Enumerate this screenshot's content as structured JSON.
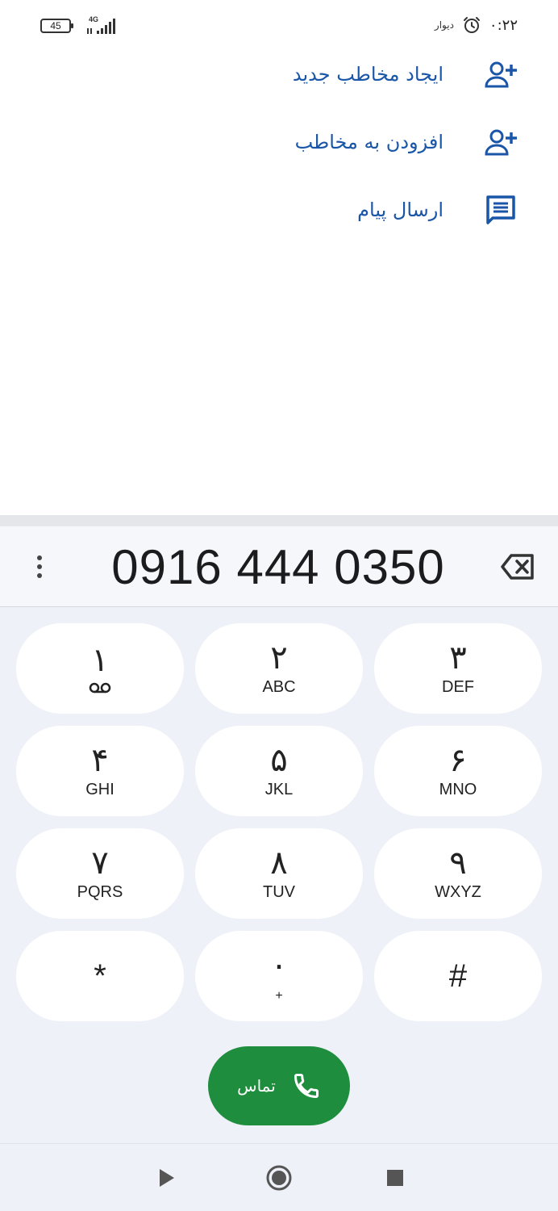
{
  "status_bar": {
    "battery": "45",
    "network": "4G",
    "app_label": "دیوار",
    "time": "۰:۲۲"
  },
  "actions": [
    {
      "label": "ایجاد مخاطب جدید",
      "icon": "person-add-icon"
    },
    {
      "label": "افزودن به مخاطب",
      "icon": "person-add-icon"
    },
    {
      "label": "ارسال پیام",
      "icon": "message-icon"
    }
  ],
  "dialer": {
    "number": "0916 444 0350",
    "keys": [
      {
        "digit": "۱",
        "letters": ""
      },
      {
        "digit": "۲",
        "letters": "ABC"
      },
      {
        "digit": "۳",
        "letters": "DEF"
      },
      {
        "digit": "۴",
        "letters": "GHI"
      },
      {
        "digit": "۵",
        "letters": "JKL"
      },
      {
        "digit": "۶",
        "letters": "MNO"
      },
      {
        "digit": "۷",
        "letters": "PQRS"
      },
      {
        "digit": "۸",
        "letters": "TUV"
      },
      {
        "digit": "۹",
        "letters": "WXYZ"
      },
      {
        "digit": "*",
        "letters": ""
      },
      {
        "digit": "۰",
        "letters": "+"
      },
      {
        "digit": "#",
        "letters": ""
      }
    ],
    "call_label": "تماس"
  },
  "colors": {
    "accent": "#1a56a8",
    "call_green": "#1e8e3e",
    "panel_bg": "#eef2f8"
  }
}
